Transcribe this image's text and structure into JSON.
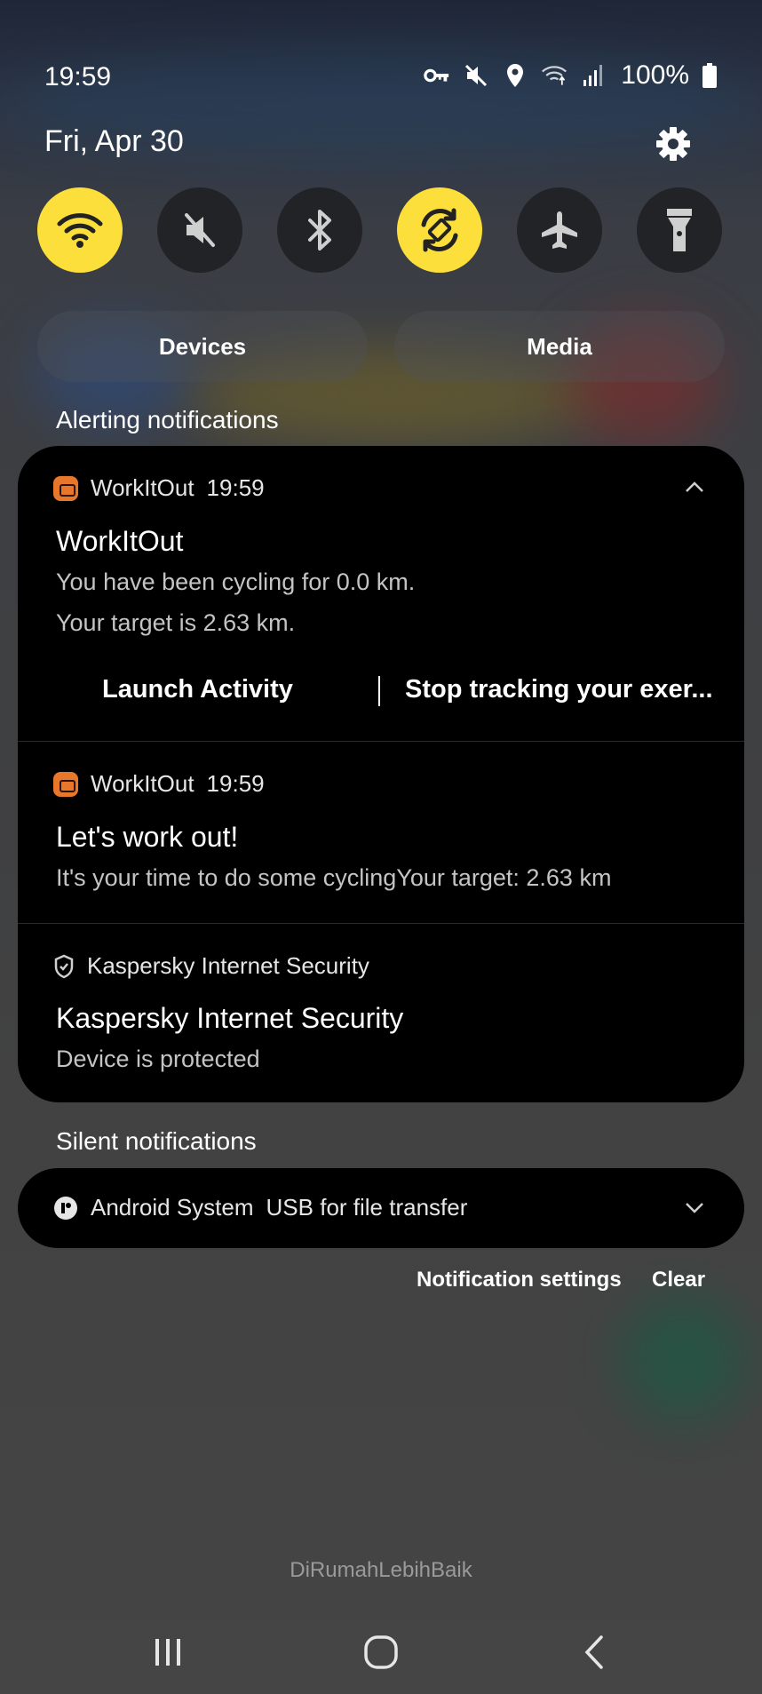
{
  "status_bar": {
    "time": "19:59",
    "battery": "100%",
    "icons": [
      "vpn-key-icon",
      "mute-icon",
      "location-icon",
      "wifi-data-icon",
      "signal-icon",
      "battery-icon"
    ]
  },
  "header": {
    "date": "Fri, Apr 30"
  },
  "quick_settings": [
    {
      "name": "wifi",
      "icon": "wifi-icon",
      "active": true
    },
    {
      "name": "sound",
      "icon": "mute-icon",
      "active": false
    },
    {
      "name": "bluetooth",
      "icon": "bluetooth-icon",
      "active": false
    },
    {
      "name": "auto-rotate",
      "icon": "rotate-icon",
      "active": true
    },
    {
      "name": "airplane",
      "icon": "airplane-icon",
      "active": false
    },
    {
      "name": "flashlight",
      "icon": "flashlight-icon",
      "active": false
    }
  ],
  "devices_label": "Devices",
  "media_label": "Media",
  "alerting_label": "Alerting notifications",
  "silent_label": "Silent notifications",
  "notifications": [
    {
      "app": "WorkItOut",
      "time": "19:59",
      "title": "WorkItOut",
      "body_line1": "You have been cycling for 0.0 km.",
      "body_line2": "Your target is 2.63 km.",
      "actions": [
        "Launch Activity",
        "Stop tracking your exer..."
      ]
    },
    {
      "app": "WorkItOut",
      "time": "19:59",
      "title": "Let's work out!",
      "body": "It's your time to do some cyclingYour target: 2.63 km"
    },
    {
      "app": "Kaspersky Internet Security",
      "title": "Kaspersky Internet Security",
      "body": "Device is protected"
    }
  ],
  "silent": {
    "app": "Android System",
    "text": "USB for file transfer"
  },
  "footer": {
    "settings_label": "Notification settings",
    "clear_label": "Clear"
  },
  "carrier": "DiRumahLebihBaik",
  "colors": {
    "accent": "#fcdf3b",
    "card_bg": "#000000",
    "app_icon": "#e8772c"
  }
}
